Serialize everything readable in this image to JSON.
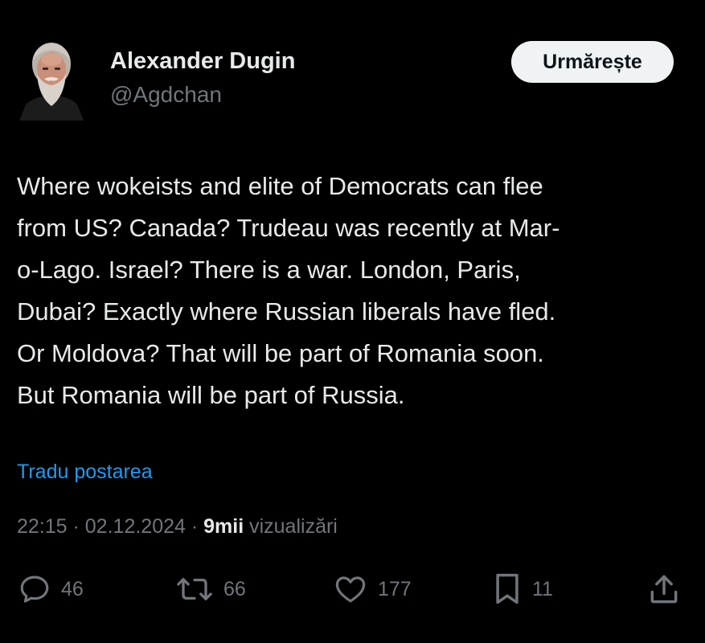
{
  "author": {
    "name": "Alexander Dugin",
    "handle": "@Agdchan"
  },
  "follow_button": {
    "label": "Urmărește"
  },
  "tweet": {
    "lines": [
      "Where wokeists and elite of Democrats can flee",
      "from US? Canada? Trudeau was recently at Mar-",
      "o-Lago. Israel? There is a war. London, Paris,",
      "Dubai? Exactly where Russian liberals have fled.",
      "Or Moldova? That will be part of Romania soon.",
      "But Romania will be part of Russia."
    ]
  },
  "translate_link": "Tradu postarea",
  "meta": {
    "time": "22:15",
    "separator": " · ",
    "date": "02.12.2024",
    "views_count": "9mii",
    "views_label": " vizualizări"
  },
  "actions": {
    "replies": "46",
    "reposts": "66",
    "likes": "177",
    "bookmarks": "11"
  },
  "icons": {
    "reply": "speech-bubble-icon",
    "repost": "repost-arrows-icon",
    "like": "heart-icon",
    "bookmark": "bookmark-icon",
    "share": "share-upload-icon"
  },
  "colors": {
    "background": "#000000",
    "text_primary": "#e7e9ea",
    "text_secondary": "#71767b",
    "link": "#1d9bf0",
    "follow_button_bg": "#eff3f4",
    "follow_button_text": "#0f1419"
  }
}
